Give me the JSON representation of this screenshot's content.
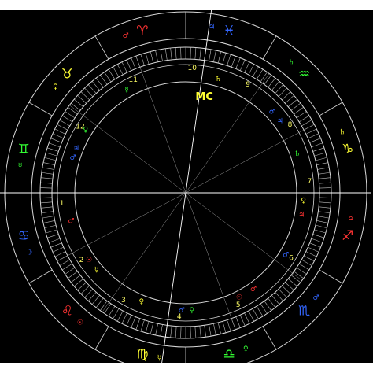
{
  "chart_data": {
    "type": "natal-wheel",
    "colors": {
      "background": "#000000",
      "lines": "#d8d8d8",
      "fire": "#ff3333",
      "earth": "#ffff33",
      "air": "#33ff33",
      "water": "#3366ff"
    },
    "signs": [
      {
        "name": "aries-icon",
        "glyph": "♈",
        "color": "#ff3333"
      },
      {
        "name": "taurus-icon",
        "glyph": "♉",
        "color": "#ffff33"
      },
      {
        "name": "gemini-icon",
        "glyph": "♊",
        "color": "#33ff33"
      },
      {
        "name": "cancer-icon",
        "glyph": "♋",
        "color": "#3366ff"
      },
      {
        "name": "leo-icon",
        "glyph": "♌",
        "color": "#ff3333"
      },
      {
        "name": "virgo-icon",
        "glyph": "♍",
        "color": "#ffff33"
      },
      {
        "name": "libra-icon",
        "glyph": "♎",
        "color": "#33ff33"
      },
      {
        "name": "scorpio-icon",
        "glyph": "♏",
        "color": "#3366ff"
      },
      {
        "name": "sagittarius-icon",
        "glyph": "♐",
        "color": "#ff3333"
      },
      {
        "name": "capricorn-icon",
        "glyph": "♑",
        "color": "#ffff33"
      },
      {
        "name": "aquarius-icon",
        "glyph": "♒",
        "color": "#33ff33"
      },
      {
        "name": "pisces-icon",
        "glyph": "♓",
        "color": "#3366ff"
      }
    ],
    "sign_start_longitudes": [
      0,
      30,
      60,
      90,
      120,
      150,
      180,
      210,
      240,
      270,
      300,
      330
    ],
    "ascendant_longitude": 90,
    "midheaven_label": "MC",
    "house_numbers": [
      "1",
      "2",
      "3",
      "4",
      "5",
      "6",
      "7",
      "8",
      "9",
      "10",
      "11",
      "12"
    ],
    "house_cusp_longitudes": [
      90,
      118,
      145,
      172,
      200,
      233,
      270,
      298,
      325,
      352,
      20,
      53
    ],
    "ruler_glyphs": [
      {
        "name": "mars-icon",
        "glyph": "♂",
        "color": "#ff3333",
        "longitude": 12
      },
      {
        "name": "venus-icon",
        "glyph": "♀",
        "color": "#ffff33",
        "longitude": 42
      },
      {
        "name": "mercury-icon",
        "glyph": "☿",
        "color": "#33ff33",
        "longitude": 72
      },
      {
        "name": "moon-icon",
        "glyph": "☽",
        "color": "#3366ff",
        "longitude": 102
      },
      {
        "name": "sun-icon",
        "glyph": "☉",
        "color": "#ff3333",
        "longitude": 132
      },
      {
        "name": "mercury-icon",
        "glyph": "☿",
        "color": "#ffff33",
        "longitude": 162
      },
      {
        "name": "venus-icon",
        "glyph": "♀",
        "color": "#33ff33",
        "longitude": 192
      },
      {
        "name": "mars-icon",
        "glyph": "♂",
        "color": "#3366ff",
        "longitude": 222
      },
      {
        "name": "jupiter-icon",
        "glyph": "♃",
        "color": "#ff3333",
        "longitude": 252
      },
      {
        "name": "saturn-icon",
        "glyph": "♄",
        "color": "#ffff33",
        "longitude": 282
      },
      {
        "name": "saturn-icon",
        "glyph": "♄",
        "color": "#33ff33",
        "longitude": 312
      },
      {
        "name": "jupiter-icon",
        "glyph": "♃",
        "color": "#3366ff",
        "longitude": 342
      }
    ],
    "house_glyphs": [
      {
        "name": "mars-icon",
        "glyph": "♂",
        "color": "#ff3333",
        "longitude": 104
      },
      {
        "name": "sun-icon",
        "glyph": "☉",
        "color": "#ff3333",
        "longitude": 125
      },
      {
        "name": "mercury-icon",
        "glyph": "☿",
        "color": "#ffff33",
        "longitude": 131
      },
      {
        "name": "venus-icon",
        "glyph": "♀",
        "color": "#ffff33",
        "longitude": 158
      },
      {
        "name": "mars-icon",
        "glyph": "♂",
        "color": "#3366ff",
        "longitude": 178
      },
      {
        "name": "venus-icon",
        "glyph": "♀",
        "color": "#33ff33",
        "longitude": 183
      },
      {
        "name": "sun-icon",
        "glyph": "☉",
        "color": "#ff3333",
        "longitude": 207
      },
      {
        "name": "mars-icon",
        "glyph": "♂",
        "color": "#ff3333",
        "longitude": 215
      },
      {
        "name": "mars-icon",
        "glyph": "♂",
        "color": "#3366ff",
        "longitude": 238
      },
      {
        "name": "jupiter-icon",
        "glyph": "♃",
        "color": "#ff3333",
        "longitude": 259
      },
      {
        "name": "venus-icon",
        "glyph": "♀",
        "color": "#ffff33",
        "longitude": 266
      },
      {
        "name": "saturn-icon",
        "glyph": "♄",
        "color": "#33ff33",
        "longitude": 289
      },
      {
        "name": "jupiter-icon",
        "glyph": "♃",
        "color": "#3366ff",
        "longitude": 307
      },
      {
        "name": "mars-icon",
        "glyph": "♂",
        "color": "#3366ff",
        "longitude": 313
      },
      {
        "name": "saturn-icon",
        "glyph": "♄",
        "color": "#ffff33",
        "longitude": 344
      },
      {
        "name": "mercury-icon",
        "glyph": "☿",
        "color": "#33ff33",
        "longitude": 30
      },
      {
        "name": "venus-icon",
        "glyph": "♀",
        "color": "#33ff33",
        "longitude": 58
      },
      {
        "name": "jupiter-icon",
        "glyph": "♃",
        "color": "#3366ff",
        "longitude": 68
      },
      {
        "name": "mars-icon",
        "glyph": "♂",
        "color": "#3366ff",
        "longitude": 73
      }
    ]
  }
}
